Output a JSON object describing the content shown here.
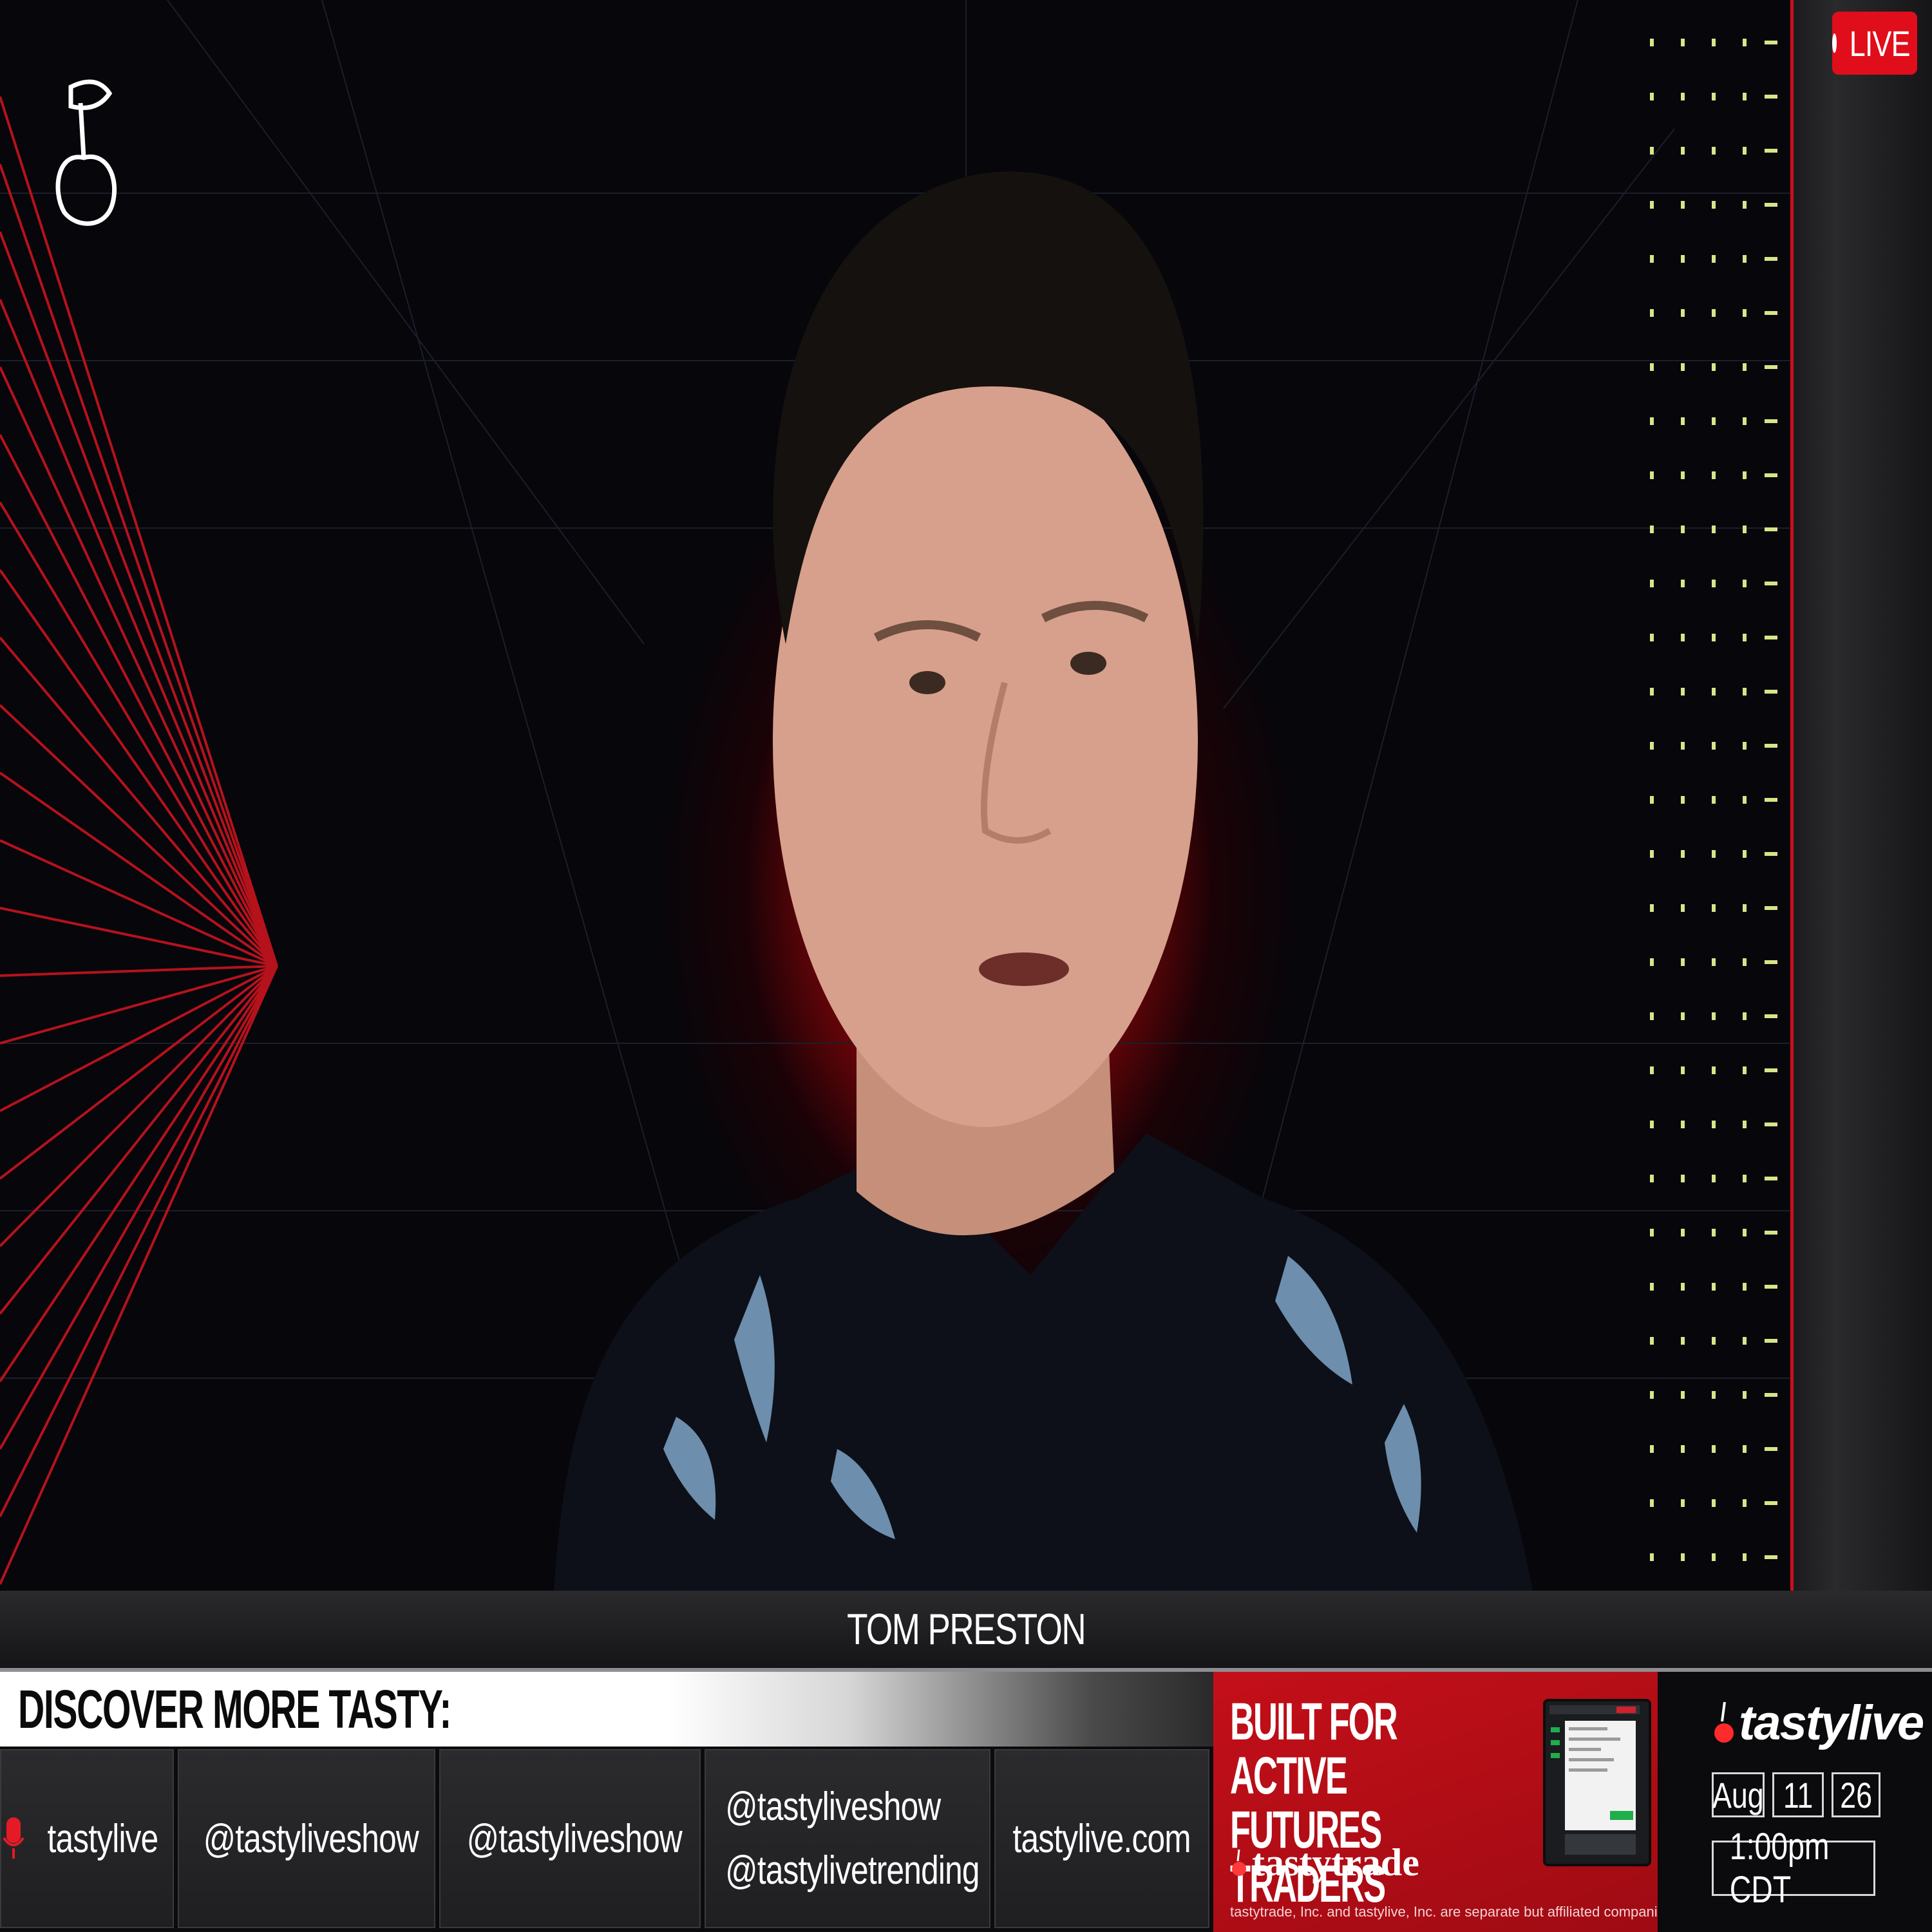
{
  "badge": {
    "live_label": "LIVE"
  },
  "lower_third": {
    "name": "TOM PRESTON"
  },
  "discover": {
    "heading": "DISCOVER MORE TASTY:",
    "socials": [
      {
        "icon": "microphone-icon",
        "label": "tastylive"
      },
      {
        "icon": "x-icon",
        "label": "@tastyliveshow"
      },
      {
        "icon": "instagram-icon",
        "label": "@tastyliveshow"
      },
      {
        "icon": "youtube-icon",
        "labels": [
          "@tastyliveshow",
          "@tastylivetrending"
        ]
      },
      {
        "icon": "",
        "label": "tastylive.com"
      }
    ]
  },
  "ad": {
    "headline_line1": "BUILT FOR ACTIVE",
    "headline_line2": "FUTURES TRADERS",
    "brand": "tastytrade",
    "disclaimer": "tastytrade, Inc. and tastylive, Inc. are separate but affiliated companies."
  },
  "brand_panel": {
    "logo": "tastylive",
    "date": {
      "month": "Aug",
      "day": "11",
      "year": "26"
    },
    "time": "1:00pm CDT"
  },
  "colors": {
    "accent_red": "#e00d1b",
    "ad_red": "#c40f19",
    "dot_green": "#d7e58a",
    "background": "#06060b"
  }
}
